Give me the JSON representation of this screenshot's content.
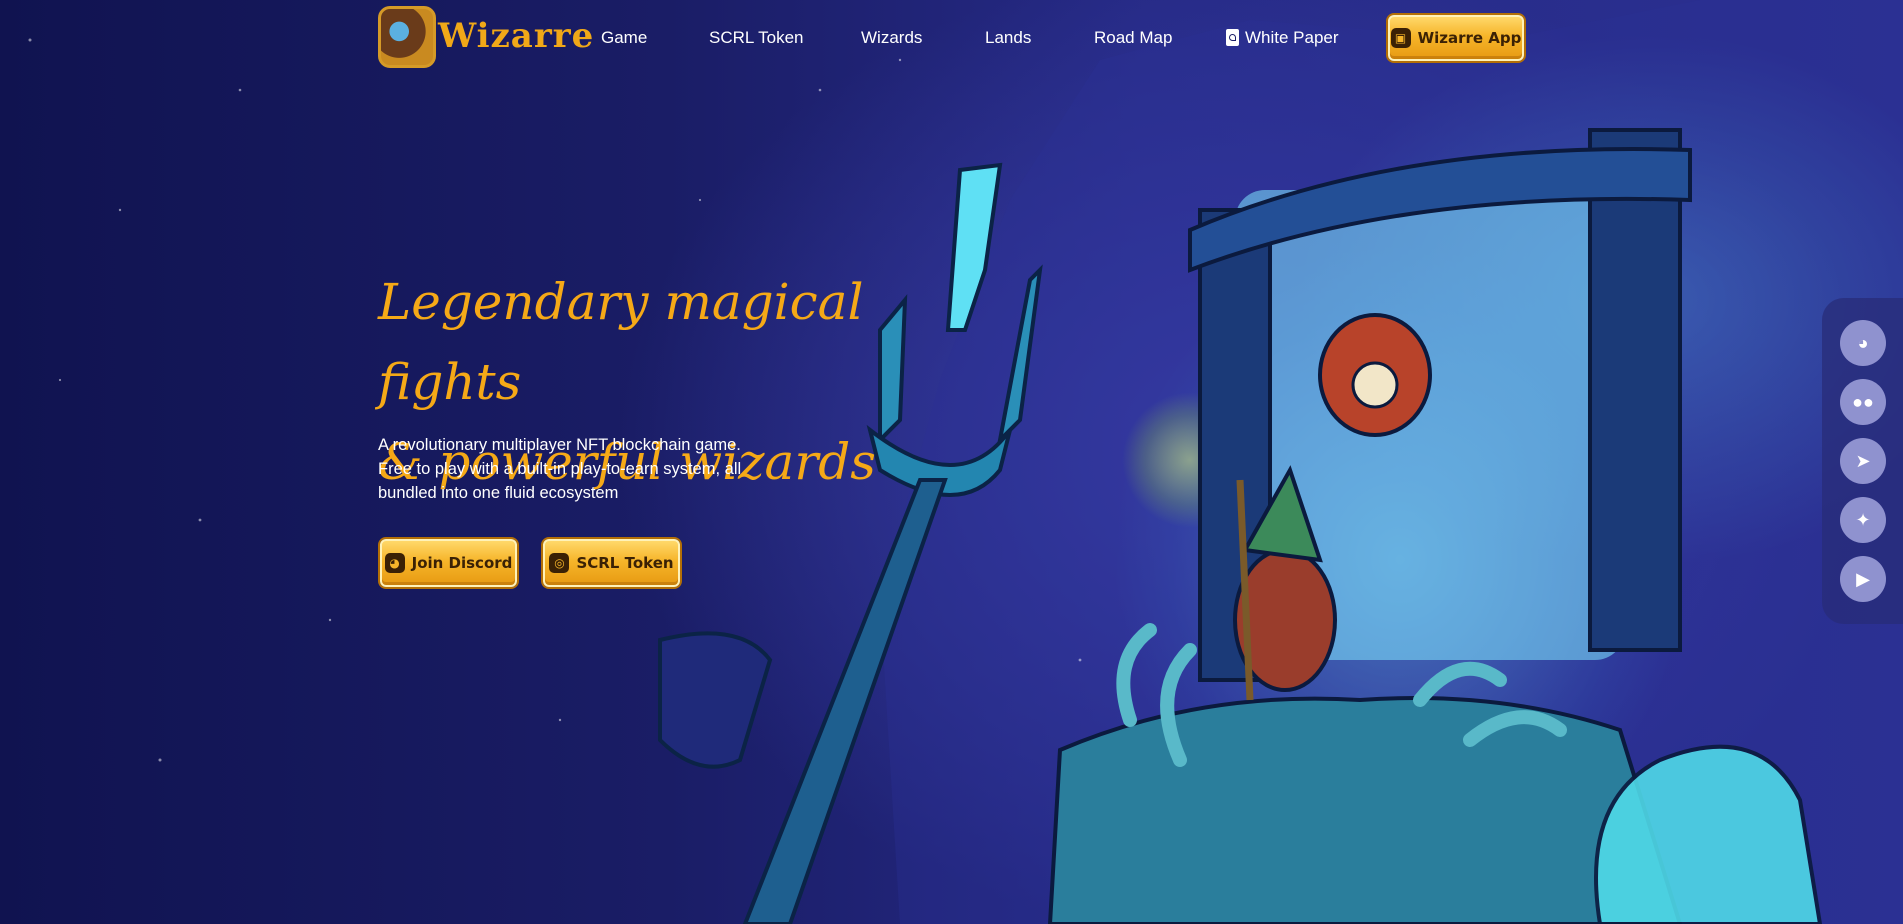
{
  "logo": {
    "text": "Wizarre",
    "icon": "wizarre-emblem-icon"
  },
  "nav": {
    "items": [
      {
        "label": "Game"
      },
      {
        "label": "SCRL Token"
      },
      {
        "label": "Wizards"
      },
      {
        "label": "Lands"
      },
      {
        "label": "Road Map"
      },
      {
        "label": "White Paper",
        "icon": "pdf-file-icon"
      }
    ],
    "app_button": {
      "label": "Wizarre App",
      "icon": "treasure-chest-icon"
    }
  },
  "hero": {
    "title_line1": "Legendary magical fights",
    "title_line2": "& powerful wizards",
    "subtitle_line1": "A revolutionary multiplayer NFT blockchain game.",
    "subtitle_line2": "Free to play with a built-in play-to-earn system, all",
    "subtitle_line3": "bundled into one fluid ecosystem",
    "discord_button": {
      "label": "Join Discord",
      "icon": "discord-icon"
    },
    "token_button": {
      "label": "SCRL Token",
      "icon": "coins-icon"
    }
  },
  "social": [
    {
      "name": "discord",
      "icon": "discord-icon"
    },
    {
      "name": "medium",
      "icon": "medium-icon"
    },
    {
      "name": "telegram",
      "icon": "telegram-icon"
    },
    {
      "name": "twitter",
      "icon": "twitter-icon"
    },
    {
      "name": "youtube",
      "icon": "youtube-icon"
    }
  ],
  "colors": {
    "gold": "#f5a917",
    "background": "#171a5c",
    "social_icon_bg": "#8f92cf"
  }
}
